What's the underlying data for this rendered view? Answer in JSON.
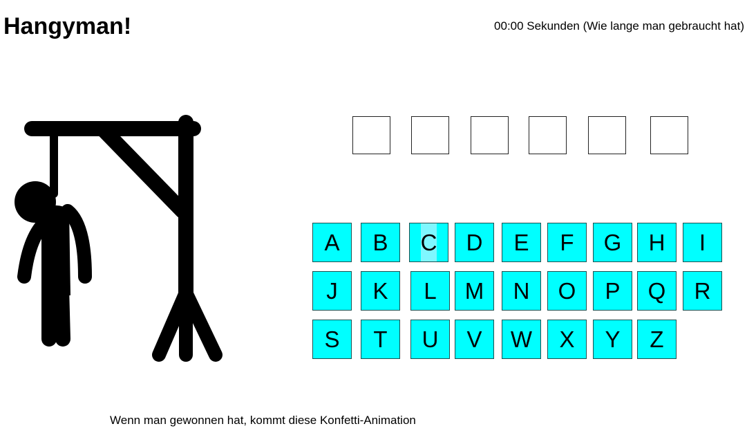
{
  "header": {
    "title": "Hangyman!",
    "timer": "00:00 Sekunden (Wie lange man gebraucht hat)"
  },
  "word": {
    "slots": [
      "",
      "",
      "",
      "",
      "",
      ""
    ]
  },
  "keyboard": {
    "rows": [
      [
        "A",
        "B",
        "C",
        "D",
        "E",
        "F",
        "G",
        "H",
        "I"
      ],
      [
        "J",
        "K",
        "L",
        "M",
        "N",
        "O",
        "P",
        "Q",
        "R"
      ],
      [
        "S",
        "T",
        "U",
        "V",
        "W",
        "X",
        "Y",
        "Z"
      ]
    ],
    "hovered_key": "C"
  },
  "footer": {
    "note": "Wenn man gewonnen hat, kommt diese Konfetti-Animation"
  },
  "colors": {
    "key_background": "#00ffff",
    "figure": "#000000",
    "background": "#ffffff"
  },
  "icons": {
    "gallows": "hangman-gallows-icon"
  }
}
